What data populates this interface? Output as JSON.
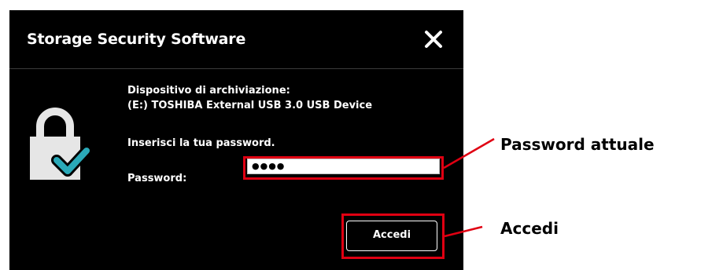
{
  "window": {
    "title": "Storage Security Software",
    "close_icon": "close-icon"
  },
  "body": {
    "device_label": "Dispositivo di archiviazione:",
    "device_name": "(E:) TOSHIBA External USB 3.0 USB Device",
    "instruction": "Inserisci la tua password.",
    "password_label": "Password:",
    "password_value": "●●●●"
  },
  "buttons": {
    "login_label": "Accedi"
  },
  "annotations": {
    "password_callout": "Password attuale",
    "login_callout": "Accedi"
  },
  "icons": {
    "lock": "lock-check-icon"
  },
  "colors": {
    "dialog_bg": "#000000",
    "lock_body": "#e6e6e6",
    "check_accent": "#2aa9b8",
    "highlight_red": "#e00012"
  }
}
